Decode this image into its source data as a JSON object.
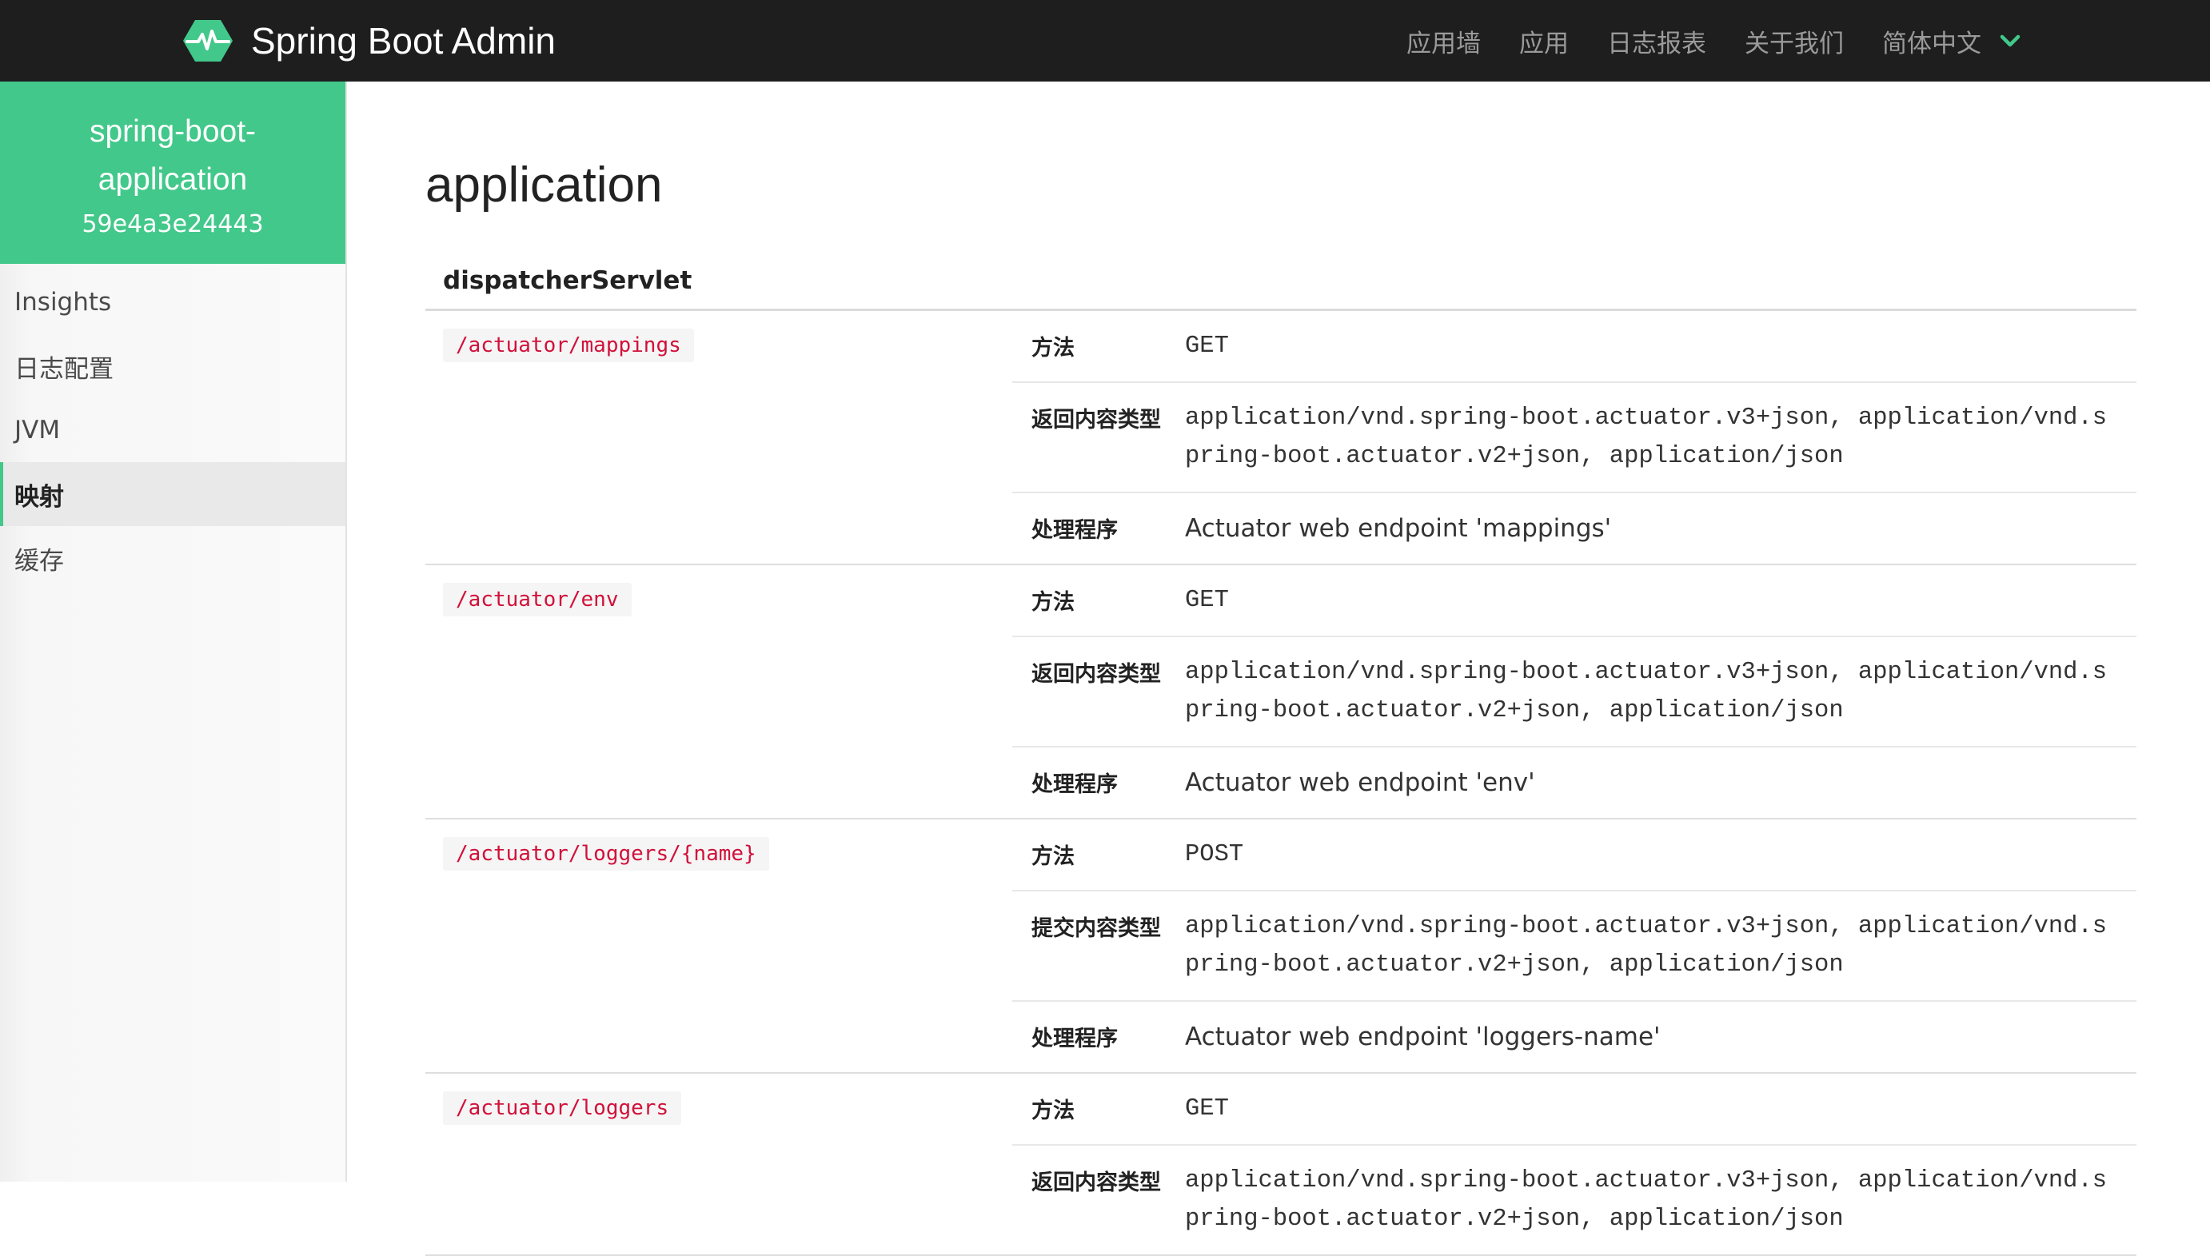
{
  "header": {
    "brand": "Spring Boot Admin",
    "brand_color": "#42c88a",
    "nav": [
      {
        "label": "应用墙"
      },
      {
        "label": "应用"
      },
      {
        "label": "日志报表"
      },
      {
        "label": "关于我们"
      }
    ],
    "language": "简体中文",
    "language_icon": "chevron-down-icon"
  },
  "sidebar": {
    "app_name": "spring-boot-application",
    "app_id": "59e4a3e24443",
    "items": [
      {
        "label": "Insights"
      },
      {
        "label": "日志配置"
      },
      {
        "label": "JVM"
      },
      {
        "label": "映射",
        "active": true
      },
      {
        "label": "缓存"
      }
    ]
  },
  "main": {
    "title": "application",
    "group": "dispatcherServlet",
    "endpoints": [
      {
        "path": "/actuator/mappings",
        "rows": [
          {
            "label": "方法",
            "value": "GET"
          },
          {
            "label": "返回内容类型",
            "value": "application/vnd.spring-boot.actuator.v3+json, application/vnd.spring-boot.actuator.v2+json, application/json"
          },
          {
            "label": "处理程序",
            "value": "Actuator web endpoint 'mappings'"
          }
        ]
      },
      {
        "path": "/actuator/env",
        "rows": [
          {
            "label": "方法",
            "value": "GET"
          },
          {
            "label": "返回内容类型",
            "value": "application/vnd.spring-boot.actuator.v3+json, application/vnd.spring-boot.actuator.v2+json, application/json"
          },
          {
            "label": "处理程序",
            "value": "Actuator web endpoint 'env'"
          }
        ]
      },
      {
        "path": "/actuator/loggers/{name}",
        "rows": [
          {
            "label": "方法",
            "value": "POST"
          },
          {
            "label": "提交内容类型",
            "value": "application/vnd.spring-boot.actuator.v3+json, application/vnd.spring-boot.actuator.v2+json, application/json"
          },
          {
            "label": "处理程序",
            "value": "Actuator web endpoint 'loggers-name'"
          }
        ]
      },
      {
        "path": "/actuator/loggers",
        "rows": [
          {
            "label": "方法",
            "value": "GET"
          },
          {
            "label": "返回内容类型",
            "value": "application/vnd.spring-boot.actuator.v3+json, application/vnd.spring-boot.actuator.v2+json, application/json"
          }
        ]
      }
    ]
  }
}
